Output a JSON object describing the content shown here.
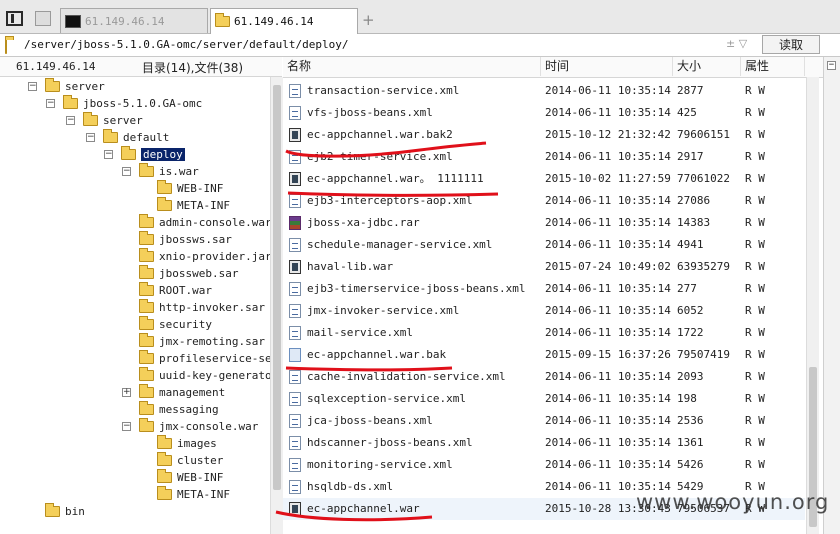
{
  "tabs": [
    {
      "label": "61.149.46.14",
      "icon": "terminal-icon",
      "active": false
    },
    {
      "label": "61.149.46.14",
      "icon": "folder-icon",
      "active": true
    }
  ],
  "new_tab_label": "+",
  "path": {
    "value": "/server/jboss-5.1.0.GA-omc/server/default/deploy/",
    "arrows": "± ▽",
    "read_button": "读取"
  },
  "left": {
    "host": "61.149.46.14",
    "counts": "目录(14),文件(38)",
    "tree": [
      {
        "label": "server",
        "exp": "-",
        "selected": false
      },
      {
        "label": "jboss-5.1.0.GA-omc",
        "exp": "-",
        "selected": false
      },
      {
        "label": "server",
        "exp": "-",
        "selected": false
      },
      {
        "label": "default",
        "exp": "-",
        "selected": false
      },
      {
        "label": "deploy",
        "exp": "-",
        "selected": true
      },
      {
        "label": "is.war",
        "exp": "-",
        "selected": false
      },
      {
        "label": "WEB-INF",
        "exp": "",
        "selected": false
      },
      {
        "label": "META-INF",
        "exp": "",
        "selected": false
      },
      {
        "label": "admin-console.war",
        "exp": "",
        "selected": false
      },
      {
        "label": "jbossws.sar",
        "exp": "",
        "selected": false
      },
      {
        "label": "xnio-provider.jar",
        "exp": "",
        "selected": false
      },
      {
        "label": "jbossweb.sar",
        "exp": "",
        "selected": false
      },
      {
        "label": "ROOT.war",
        "exp": "",
        "selected": false
      },
      {
        "label": "http-invoker.sar",
        "exp": "",
        "selected": false
      },
      {
        "label": "security",
        "exp": "",
        "selected": false
      },
      {
        "label": "jmx-remoting.sar",
        "exp": "",
        "selected": false
      },
      {
        "label": "profileservice-secu",
        "exp": "",
        "selected": false
      },
      {
        "label": "uuid-key-generator.",
        "exp": "",
        "selected": false
      },
      {
        "label": "management",
        "exp": "+",
        "selected": false
      },
      {
        "label": "messaging",
        "exp": "",
        "selected": false
      },
      {
        "label": "jmx-console.war",
        "exp": "-",
        "selected": false
      },
      {
        "label": "images",
        "exp": "",
        "selected": false
      },
      {
        "label": "cluster",
        "exp": "",
        "selected": false
      },
      {
        "label": "WEB-INF",
        "exp": "",
        "selected": false
      },
      {
        "label": "META-INF",
        "exp": "",
        "selected": false
      },
      {
        "label": "bin",
        "exp": "",
        "selected": false
      }
    ]
  },
  "columns": {
    "name": "名称",
    "time": "时间",
    "size": "大小",
    "attr": "属性"
  },
  "files": [
    {
      "name": "transaction-service.xml",
      "time": "2014-06-11 10:35:14",
      "size": "2877",
      "attr": "R W",
      "icon": "xml"
    },
    {
      "name": "vfs-jboss-beans.xml",
      "time": "2014-06-11 10:35:14",
      "size": "425",
      "attr": "R W",
      "icon": "xml"
    },
    {
      "name": "ec-appchannel.war.bak2",
      "time": "2015-10-12 21:32:42",
      "size": "79606151",
      "attr": "R W",
      "icon": "war"
    },
    {
      "name": "ejb2-timer-service.xml",
      "time": "2014-06-11 10:35:14",
      "size": "2917",
      "attr": "R W",
      "icon": "xml"
    },
    {
      "name": "ec-appchannel.war。 1111111",
      "time": "2015-10-02 11:27:59",
      "size": "77061022",
      "attr": "R W",
      "icon": "war"
    },
    {
      "name": "ejb3-interceptors-aop.xml",
      "time": "2014-06-11 10:35:14",
      "size": "27086",
      "attr": "R W",
      "icon": "xml"
    },
    {
      "name": "jboss-xa-jdbc.rar",
      "time": "2014-06-11 10:35:14",
      "size": "14383",
      "attr": "R W",
      "icon": "rar"
    },
    {
      "name": "schedule-manager-service.xml",
      "time": "2014-06-11 10:35:14",
      "size": "4941",
      "attr": "R W",
      "icon": "xml"
    },
    {
      "name": "haval-lib.war",
      "time": "2015-07-24 10:49:02",
      "size": "63935279",
      "attr": "R W",
      "icon": "war"
    },
    {
      "name": "ejb3-timerservice-jboss-beans.xml",
      "time": "2014-06-11 10:35:14",
      "size": "277",
      "attr": "R W",
      "icon": "xml"
    },
    {
      "name": "jmx-invoker-service.xml",
      "time": "2014-06-11 10:35:14",
      "size": "6052",
      "attr": "R W",
      "icon": "xml"
    },
    {
      "name": "mail-service.xml",
      "time": "2014-06-11 10:35:14",
      "size": "1722",
      "attr": "R W",
      "icon": "xml"
    },
    {
      "name": "ec-appchannel.war.bak",
      "time": "2015-09-15 16:37:26",
      "size": "79507419",
      "attr": "R W",
      "icon": "bak"
    },
    {
      "name": "cache-invalidation-service.xml",
      "time": "2014-06-11 10:35:14",
      "size": "2093",
      "attr": "R W",
      "icon": "xml"
    },
    {
      "name": "sqlexception-service.xml",
      "time": "2014-06-11 10:35:14",
      "size": "198",
      "attr": "R W",
      "icon": "xml"
    },
    {
      "name": "jca-jboss-beans.xml",
      "time": "2014-06-11 10:35:14",
      "size": "2536",
      "attr": "R W",
      "icon": "xml"
    },
    {
      "name": "hdscanner-jboss-beans.xml",
      "time": "2014-06-11 10:35:14",
      "size": "1361",
      "attr": "R W",
      "icon": "xml"
    },
    {
      "name": "monitoring-service.xml",
      "time": "2014-06-11 10:35:14",
      "size": "5426",
      "attr": "R W",
      "icon": "xml"
    },
    {
      "name": "hsqldb-ds.xml",
      "time": "2014-06-11 10:35:14",
      "size": "5429",
      "attr": "R W",
      "icon": "xml"
    },
    {
      "name": "ec-appchannel.war",
      "time": "2015-10-28 13:30:43",
      "size": "79506537",
      "attr": "R W",
      "icon": "war"
    }
  ],
  "watermark": "www.wooyun.org",
  "colors": {
    "selection": "#0a246a",
    "annotation": "#e0101a",
    "folder": "#f4cf5a"
  }
}
